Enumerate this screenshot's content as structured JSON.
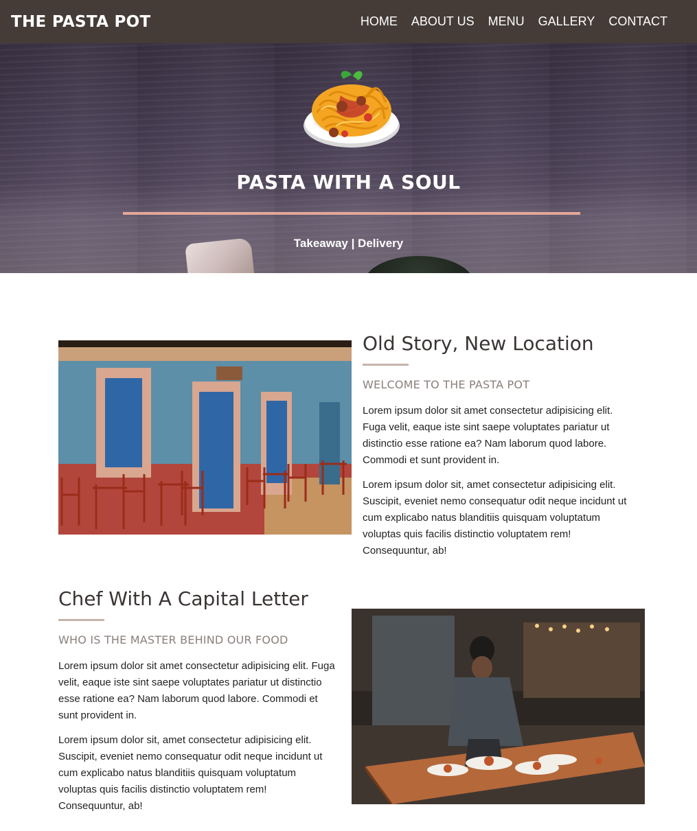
{
  "navbar": {
    "brand": "THE PASTA POT",
    "links": [
      "HOME",
      "ABOUT US",
      "MENU",
      "GALLERY",
      "CONTACT"
    ]
  },
  "hero": {
    "logo_icon": "spaghetti-plate-icon",
    "title": "PASTA WITH A SOUL",
    "subtitle": "Takeaway | Delivery"
  },
  "section1": {
    "heading": "Old Story, New Location",
    "subheading": "WELCOME TO THE PASTA POT",
    "para1": "Lorem ipsum dolor sit amet consectetur adipisicing elit. Fuga velit, eaque iste sint saepe voluptates pariatur ut distinctio esse ratione ea? Nam laborum quod labore. Commodi et sunt provident in.",
    "para2": "Lorem ipsum dolor sit, amet consectetur adipisicing elit. Suscipit, eveniet nemo consequatur odit neque incidunt ut cum explicabo natus blanditiis quisquam voluptatum voluptas quis facilis distinctio voluptatem rem! Consequuntur, ab!"
  },
  "section2": {
    "heading": "Chef With A Capital Letter",
    "subheading": "WHO IS THE MASTER BEHIND OUR FOOD",
    "para1": "Lorem ipsum dolor sit amet consectetur adipisicing elit. Fuga velit, eaque iste sint saepe voluptates pariatur ut distinctio esse ratione ea? Nam laborum quod labore. Commodi et sunt provident in.",
    "para2": "Lorem ipsum dolor sit, amet consectetur adipisicing elit. Suscipit, eveniet nemo consequatur odit neque incidunt ut cum explicabo natus blanditiis quisquam voluptatum voluptas quis facilis distinctio voluptatem rem! Consequuntur, ab!"
  },
  "colors": {
    "navbar_bg": "#453c38",
    "accent_rule": "#e3a89a",
    "short_rule": "#c5b4ad",
    "heading": "#3a3433",
    "subheading": "#8a7f7c"
  }
}
